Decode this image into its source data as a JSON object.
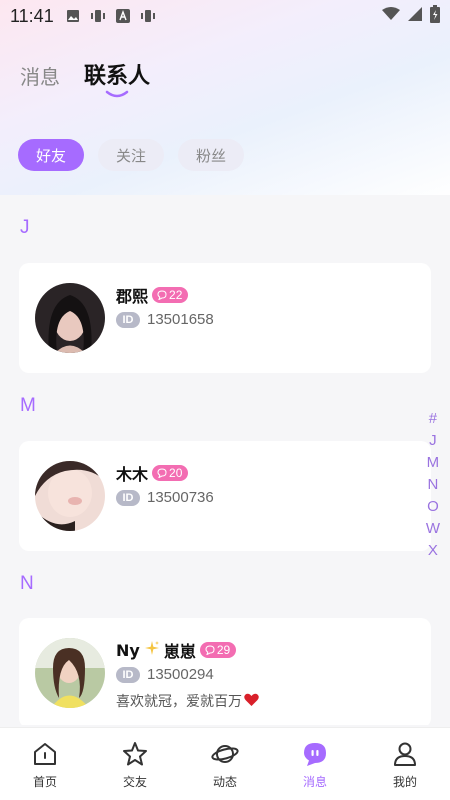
{
  "status_bar": {
    "time": "11:41",
    "icons": [
      "image-icon",
      "vibrate-icon",
      "font-icon",
      "vibrate-icon",
      "wifi-icon",
      "signal-icon",
      "battery-icon"
    ]
  },
  "header": {
    "tabs": [
      {
        "label": "消息",
        "active": false
      },
      {
        "label": "联系人",
        "active": true
      }
    ]
  },
  "filters": [
    {
      "label": "好友",
      "active": true
    },
    {
      "label": "关注",
      "active": false
    },
    {
      "label": "粉丝",
      "active": false
    }
  ],
  "sections": [
    {
      "letter": "J",
      "contacts": [
        {
          "name": "郡熙",
          "level": "22",
          "id_label": "ID",
          "id": "13501658",
          "bio": ""
        }
      ]
    },
    {
      "letter": "M",
      "contacts": [
        {
          "name": "木木",
          "level": "20",
          "id_label": "ID",
          "id": "13500736",
          "bio": ""
        }
      ]
    },
    {
      "letter": "N",
      "contacts": [
        {
          "name_prefix": "Ny",
          "name": "崽崽",
          "level": "29",
          "id_label": "ID",
          "id": "13500294",
          "bio": "喜欢就冠，爱就百万"
        }
      ]
    }
  ],
  "index_bar": [
    "#",
    "J",
    "M",
    "N",
    "O",
    "W",
    "X"
  ],
  "bottom_nav": [
    {
      "label": "首页",
      "icon": "home-icon",
      "active": false
    },
    {
      "label": "交友",
      "icon": "star-icon",
      "active": false
    },
    {
      "label": "动态",
      "icon": "planet-icon",
      "active": false
    },
    {
      "label": "消息",
      "icon": "message-icon",
      "active": true
    },
    {
      "label": "我的",
      "icon": "profile-icon",
      "active": false
    }
  ],
  "colors": {
    "accent": "#a66bff",
    "badge": "#f36db2",
    "id_tag": "#b7b9c8"
  }
}
